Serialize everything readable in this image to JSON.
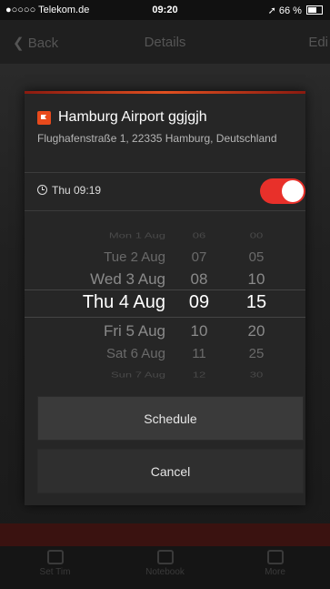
{
  "status_bar": {
    "carrier": "●○○○○ Telekom.de",
    "time": "09:20",
    "battery": "66 %",
    "battery_level": 0.66
  },
  "nav_bar": {
    "back_label": "Back",
    "title": "Details",
    "right_label": "Edi"
  },
  "tab_bar": {
    "tabs": [
      {
        "label": "Set Tim",
        "icon": "grid-icon"
      },
      {
        "label": "Notebook",
        "icon": "notebook-icon"
      },
      {
        "label": "More",
        "icon": "more-icon"
      }
    ]
  },
  "dialog": {
    "place_title": "Hamburg Airport ggjgjh",
    "place_address": "Flughafenstraße 1, 22335 Hamburg, Deutschland",
    "reminder_time": "Thu 09:19",
    "toggle_on": true,
    "picker": {
      "dates": [
        "Mon 1 Aug",
        "Tue 2 Aug",
        "Wed 3 Aug",
        "Thu 4 Aug",
        "Fri 5 Aug",
        "Sat 6 Aug",
        "Sun 7 Aug"
      ],
      "hours": [
        "06",
        "07",
        "08",
        "09",
        "10",
        "11",
        "12"
      ],
      "minutes": [
        "00",
        "05",
        "10",
        "15",
        "20",
        "25",
        "30"
      ],
      "selected_index": 3
    },
    "schedule_label": "Schedule",
    "cancel_label": "Cancel"
  },
  "colors": {
    "accent": "#e8302a",
    "flag": "#e84a1c",
    "background": "#1b1b1b",
    "dialog": "#262626"
  }
}
